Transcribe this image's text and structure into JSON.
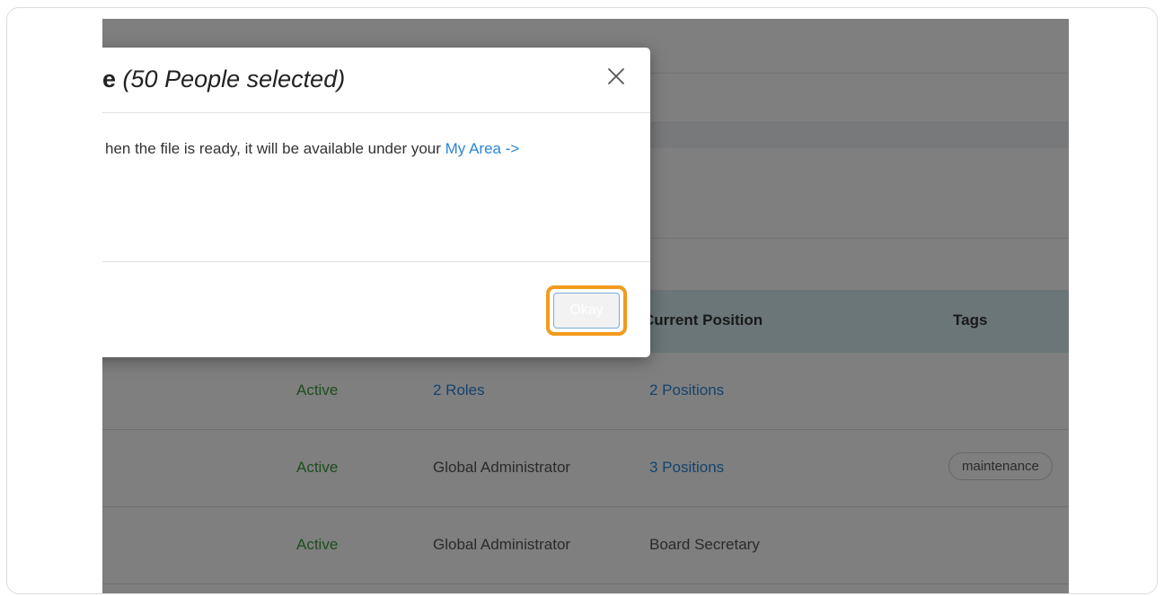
{
  "modal": {
    "title_strong": "e",
    "title_em": "(50 People selected)",
    "body_prefix": "hen the file is ready, it will be available under your ",
    "body_link": "My Area ->",
    "okay_label": "Okay"
  },
  "table": {
    "headers": {
      "current_position": "Current Position",
      "tags": "Tags"
    },
    "rows": [
      {
        "status": "Active",
        "role": "2 Roles",
        "position": "2 Positions",
        "tag": ""
      },
      {
        "status": "Active",
        "role": "Global Administrator",
        "position": "3 Positions",
        "tag": "maintenance"
      },
      {
        "status": "Active",
        "role": "Global Administrator",
        "position": "Board Secretary",
        "tag": ""
      }
    ]
  },
  "colors": {
    "accent_link": "#2a86d8",
    "status_active": "#3c9a3c",
    "focus_highlight": "#f39a1c"
  },
  "icons": {
    "close": "close-icon"
  }
}
